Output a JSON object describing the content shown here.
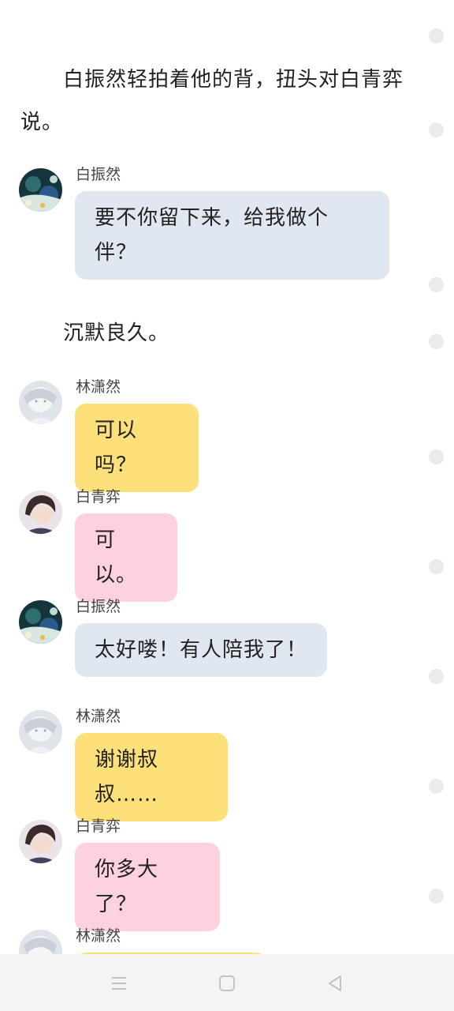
{
  "narration": [
    "白振然轻拍着他的背，扭头对白青弈说。",
    "沉默良久。"
  ],
  "messages": [
    {
      "speaker": "白振然",
      "text_lines": [
        "要不你留下来，给我做个",
        "伴？"
      ],
      "bubble_color": "#e1e7f0",
      "avatar": "baizhenran-avatar"
    },
    {
      "speaker": "林潇然",
      "text_lines": [
        "可以吗？"
      ],
      "bubble_color": "#fde07a",
      "avatar": "linxiaoran-avatar"
    },
    {
      "speaker": "白青弈",
      "text_lines": [
        "可以。"
      ],
      "bubble_color": "#fdd2de",
      "avatar": "baiqingyi-avatar"
    },
    {
      "speaker": "白振然",
      "text_lines": [
        "太好喽！有人陪我了！"
      ],
      "bubble_color": "#e1e7f0",
      "avatar": "baizhenran-avatar"
    },
    {
      "speaker": "林潇然",
      "text_lines": [
        "谢谢叔叔……"
      ],
      "bubble_color": "#fde07a",
      "avatar": "linxiaoran-avatar"
    },
    {
      "speaker": "白青弈",
      "text_lines": [
        "你多大了？"
      ],
      "bubble_color": "#fdd2de",
      "avatar": "baiqingyi-avatar"
    },
    {
      "speaker": "林潇然",
      "text_lines": [
        ""
      ],
      "bubble_color": "#fde07a",
      "avatar": "linxiaoran-avatar"
    }
  ],
  "navbar": {
    "buttons": [
      "menu-icon",
      "home-icon",
      "back-icon"
    ]
  }
}
